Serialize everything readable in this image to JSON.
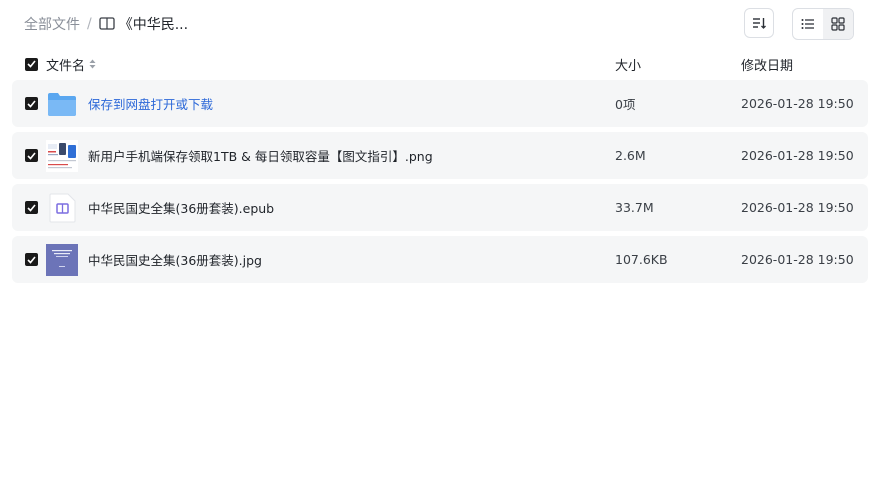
{
  "breadcrumb": {
    "root": "全部文件",
    "separator": "/",
    "current": "《中华民..."
  },
  "toolbar": {
    "sort_icon": "sort-icon",
    "view_list_icon": "list-view-icon",
    "view_grid_icon": "grid-view-icon",
    "active_view": "list"
  },
  "columns": {
    "name": "文件名",
    "size": "大小",
    "date": "修改日期"
  },
  "files": [
    {
      "name": "保存到网盘打开或下载",
      "size": "0项",
      "date": "2026-01-28 19:50",
      "type": "folder",
      "checked": true,
      "is_link": true
    },
    {
      "name": "新用户手机端保存领取1TB & 每日领取容量【图文指引】.png",
      "size": "2.6M",
      "date": "2026-01-28 19:50",
      "type": "image-png",
      "checked": true,
      "is_link": false
    },
    {
      "name": "中华民国史全集(36册套装).epub",
      "size": "33.7M",
      "date": "2026-01-28 19:50",
      "type": "epub",
      "checked": true,
      "is_link": false
    },
    {
      "name": "中华民国史全集(36册套装).jpg",
      "size": "107.6KB",
      "date": "2026-01-28 19:50",
      "type": "image-jpg",
      "checked": true,
      "is_link": false
    }
  ],
  "colors": {
    "link": "#2c68d8",
    "row_bg": "#f5f6f7",
    "folder": "#5aa7f0",
    "checkbox": "#1a1a1a"
  }
}
